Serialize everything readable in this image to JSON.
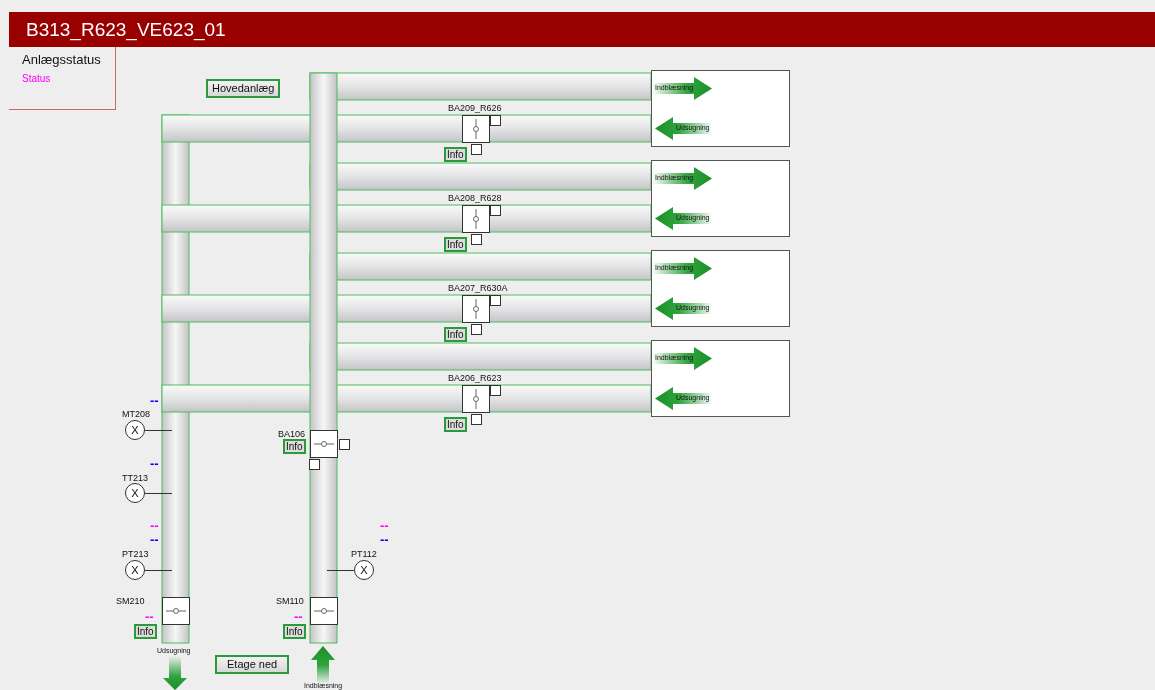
{
  "header": {
    "title": "B313_R623_VE623_01"
  },
  "status_panel": {
    "heading": "Anlægsstatus",
    "link": "Status"
  },
  "main_plant_button": "Hovedanlæg",
  "zones": [
    {
      "damper": "BA209_R626",
      "info": "Info",
      "supply_label": "Indblæsning",
      "exhaust_label": "Udsugning"
    },
    {
      "damper": "BA208_R628",
      "info": "Info",
      "supply_label": "Indblæsning",
      "exhaust_label": "Udsugning"
    },
    {
      "damper": "BA207_R630A",
      "info": "Info",
      "supply_label": "Indblæsning",
      "exhaust_label": "Udsugning"
    },
    {
      "damper": "BA206_R623",
      "info": "Info",
      "supply_label": "Indblæsning",
      "exhaust_label": "Udsugning"
    }
  ],
  "supply_damper": {
    "name": "BA106",
    "info": "Info"
  },
  "sensors": [
    {
      "name": "MT208",
      "symbol": "X",
      "values": [
        {
          "text": "--",
          "color": "#0000ff"
        }
      ]
    },
    {
      "name": "TT213",
      "symbol": "X",
      "values": [
        {
          "text": "--",
          "color": "#0000ff"
        }
      ]
    },
    {
      "name": "PT213",
      "symbol": "X",
      "values": [
        {
          "text": "--",
          "color": "#ff00ff"
        },
        {
          "text": "--",
          "color": "#0000ff"
        }
      ]
    },
    {
      "name": "PT112",
      "symbol": "X",
      "values": [
        {
          "text": "--",
          "color": "#ff00ff"
        },
        {
          "text": "--",
          "color": "#0000ff"
        }
      ]
    }
  ],
  "fan_dampers": [
    {
      "name": "SM210",
      "info": "Info",
      "values": [
        {
          "text": "--",
          "color": "#ff00ff"
        }
      ]
    },
    {
      "name": "SM110",
      "info": "Info",
      "values": [
        {
          "text": "--",
          "color": "#ff00ff"
        }
      ]
    }
  ],
  "exhaust_outlet_label": "Udsugning",
  "floor_down_button": "Etage ned",
  "supply_inlet_label": "Indblæsning"
}
